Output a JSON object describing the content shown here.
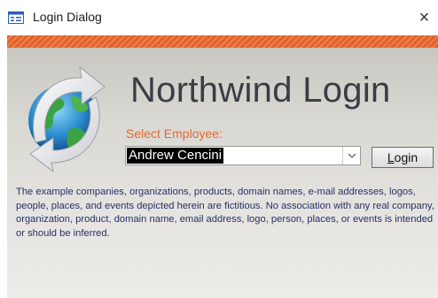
{
  "window": {
    "title": "Login Dialog",
    "close_glyph": "×",
    "icon": "form-window-icon"
  },
  "header": {
    "title": "Northwind Login",
    "logo_icon": "globe-refresh-icon"
  },
  "employee": {
    "label": "Select Employee:",
    "selected": "Andrew Cencini",
    "dropdown_icon": "chevron-down-icon"
  },
  "login_button": {
    "accel": "L",
    "rest": "ogin"
  },
  "disclaimer": "The example companies, organizations, products, domain names, e-mail addresses, logos, people, places, and events depicted herein are fictitious.  No association with any real company, organization, product, domain name, email address, logo, person, places, or events is intended or should be inferred.",
  "colors": {
    "accent": "#e06a33",
    "heading": "#3a3d44",
    "notice_text": "#24306a"
  }
}
